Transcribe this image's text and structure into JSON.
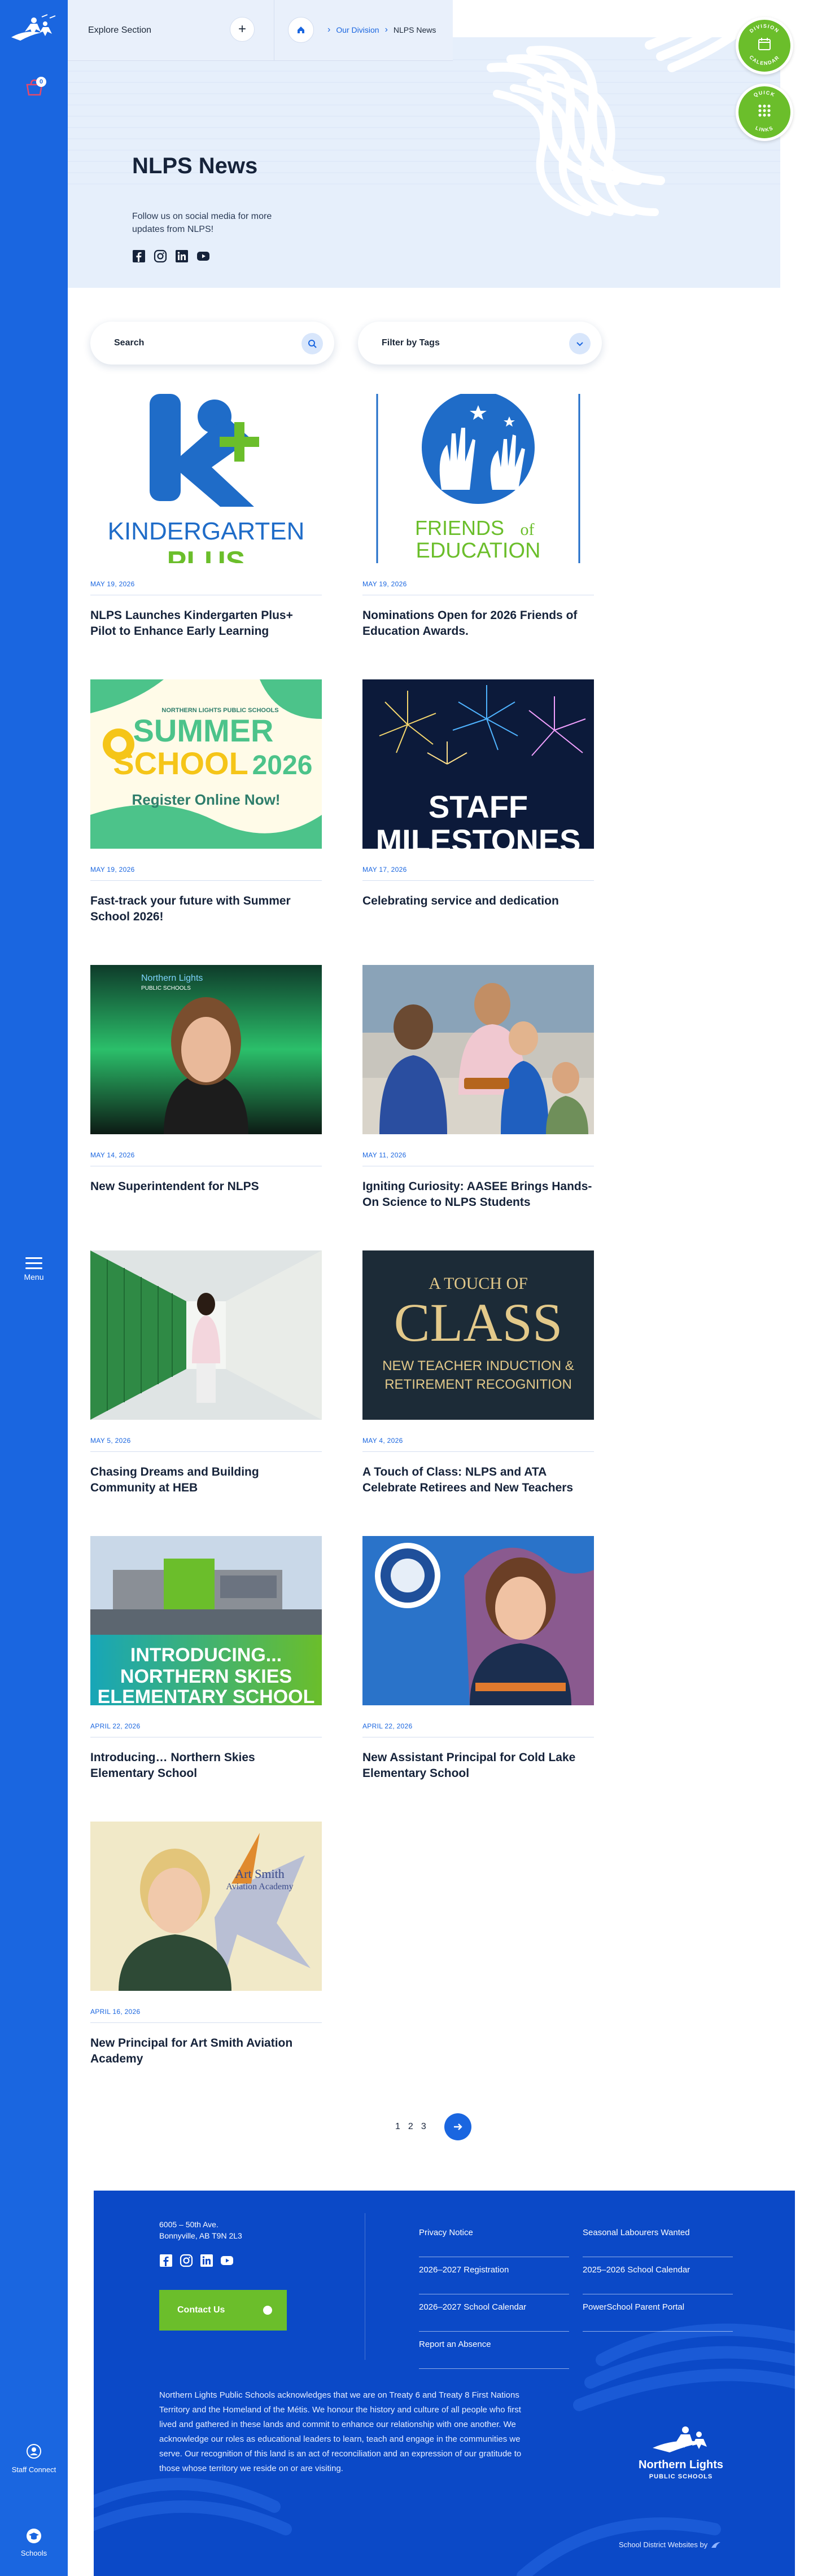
{
  "rail": {
    "bag_count": "0",
    "menu_label": "Menu",
    "staff_label": "Staff Connect",
    "schools_label": "Schools"
  },
  "topbar": {
    "explore_label": "Explore Section",
    "breadcrumb": [
      "Our Division",
      "NLPS News"
    ]
  },
  "fabs": {
    "calendar_label": "DIVISION CALENDAR",
    "quick_links_label": "QUICK LINKS"
  },
  "hero": {
    "title": "NLPS News",
    "follow_text": "Follow us on social media for more updates from NLPS!"
  },
  "filters": {
    "search_label": "Search",
    "tags_label": "Filter by Tags"
  },
  "news": [
    {
      "date": "MAY 19, 2026",
      "title": "NLPS Launches Kindergarten Plus+ Pilot to Enhance Early Learning",
      "image": "kindergarten-plus-logo"
    },
    {
      "date": "MAY 19, 2026",
      "title": "Nominations Open for 2026 Friends of Education Awards.",
      "image": "friends-of-education-logo"
    },
    {
      "date": "MAY 19, 2026",
      "title": "Fast-track your future with Summer School 2026!",
      "image": "summer-school-2026"
    },
    {
      "date": "MAY 17, 2026",
      "title": "Celebrating service and dedication",
      "image": "staff-milestones-fireworks"
    },
    {
      "date": "MAY 14, 2026",
      "title": "New Superintendent for NLPS",
      "image": "superintendent-portrait"
    },
    {
      "date": "MAY 11, 2026",
      "title": "Igniting Curiosity: AASEE Brings Hands-On Science to NLPS Students",
      "image": "students-science"
    },
    {
      "date": "MAY 5, 2026",
      "title": "Chasing Dreams and Building Community at HEB",
      "image": "student-lockers"
    },
    {
      "date": "MAY 4, 2026",
      "title": "A Touch of Class: NLPS and ATA Celebrate Retirees and New Teachers",
      "image": "a-touch-of-class"
    },
    {
      "date": "APRIL 22, 2026",
      "title": "Introducing… Northern Skies Elementary School",
      "image": "northern-skies-school"
    },
    {
      "date": "APRIL 22, 2026",
      "title": "New Assistant Principal for Cold Lake Elementary School",
      "image": "assistant-principal-portrait"
    },
    {
      "date": "APRIL 16, 2026",
      "title": "New Principal for Art Smith Aviation Academy",
      "image": "principal-aviation-portrait"
    }
  ],
  "image_text": {
    "kinder_1": "KINDERGARTEN",
    "kinder_2": "PLUS",
    "friends_1": "FRIENDS",
    "friends_of": "of",
    "friends_2": "EDUCATION",
    "summer_small": "NORTHERN LIGHTS PUBLIC SCHOOLS",
    "summer_1": "SUMMER",
    "summer_2": "SCHOOL",
    "summer_year": "2026",
    "summer_cta": "Register Online Now!",
    "staff_1": "STAFF",
    "staff_2": "MILESTONES",
    "superint_logo_1": "Northern Lights",
    "superint_logo_2": "PUBLIC SCHOOLS",
    "class_1": "A TOUCH OF",
    "class_2": "CLASS",
    "class_3": "NEW TEACHER INDUCTION &",
    "class_4": "RETIREMENT RECOGNITION",
    "skies_1": "INTRODUCING...",
    "skies_2": "NORTHERN SKIES",
    "skies_3": "ELEMENTARY SCHOOL",
    "aviation_1": "Art Smith",
    "aviation_2": "Aviation Academy"
  },
  "pagination": {
    "pages": [
      "1",
      "2",
      "3"
    ]
  },
  "footer": {
    "address_1": "6005 – 50th Ave.",
    "address_2": "Bonnyville, AB T9N 2L3",
    "contact_label": "Contact Us",
    "links_col1": [
      "Privacy Notice",
      "2026–2027 Registration",
      "2026–2027 School Calendar",
      "Report an Absence"
    ],
    "links_col2": [
      "Seasonal Labourers Wanted",
      "2025–2026 School Calendar",
      "PowerSchool Parent Portal"
    ],
    "land_ack": "Northern Lights Public Schools acknowledges that we are on Treaty 6 and Treaty 8 First Nations Territory and the Homeland of the Métis. We honour the history and culture of all people who first lived and gathered in these lands and commit to enhance our relationship with one another. We acknowledge our roles as educational leaders to learn, teach and engage in the communities we serve. Our recognition of this land is an act of reconciliation and an expression of our gratitude to those whose territory we reside on or are visiting.",
    "logo_line1": "Northern Lights",
    "logo_line2": "PUBLIC SCHOOLS",
    "credit": "School District Websites by"
  },
  "colors": {
    "brand_blue": "#1a66e0",
    "footer_blue": "#0b49c7",
    "accent_green": "#6bbe2b",
    "hero_bg": "#e6effb"
  }
}
